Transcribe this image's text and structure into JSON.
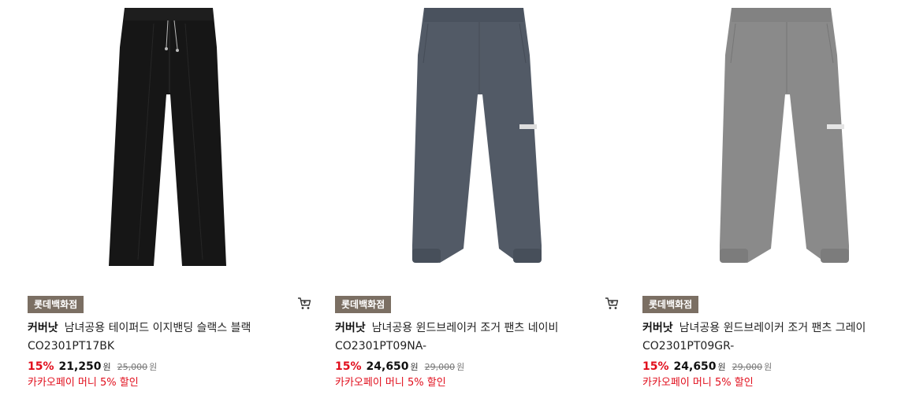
{
  "products": [
    {
      "badge": "롯데백화점",
      "brand": "커버낫",
      "title": "남녀공용 테이퍼드 이지밴딩 슬랙스 블랙",
      "code": "CO2301PT17BK",
      "discount": "15%",
      "price": "21,250",
      "currency": "원",
      "original_price": "25,000",
      "promo": "카카오페이 머니 5% 할인",
      "image_icon": "black-slacks-image",
      "pants_color": "#161616"
    },
    {
      "badge": "롯데백화점",
      "brand": "커버낫",
      "title": "남녀공용 윈드브레이커 조거 팬츠 네이비",
      "code": "CO2301PT09NA-",
      "discount": "15%",
      "price": "24,650",
      "currency": "원",
      "original_price": "29,000",
      "promo": "카카오페이 머니 5% 할인",
      "image_icon": "navy-jogger-image",
      "pants_color": "#525a66"
    },
    {
      "badge": "롯데백화점",
      "brand": "커버낫",
      "title": "남녀공용 윈드브레이커 조거 팬츠 그레이",
      "code": "CO2301PT09GR-",
      "discount": "15%",
      "price": "24,650",
      "currency": "원",
      "original_price": "29,000",
      "promo": "카카오페이 머니 5% 할인",
      "image_icon": "grey-jogger-image",
      "pants_color": "#8a8a8a"
    }
  ],
  "colors": {
    "badge_bg": "#7b6f63",
    "discount": "#e10e1c"
  }
}
